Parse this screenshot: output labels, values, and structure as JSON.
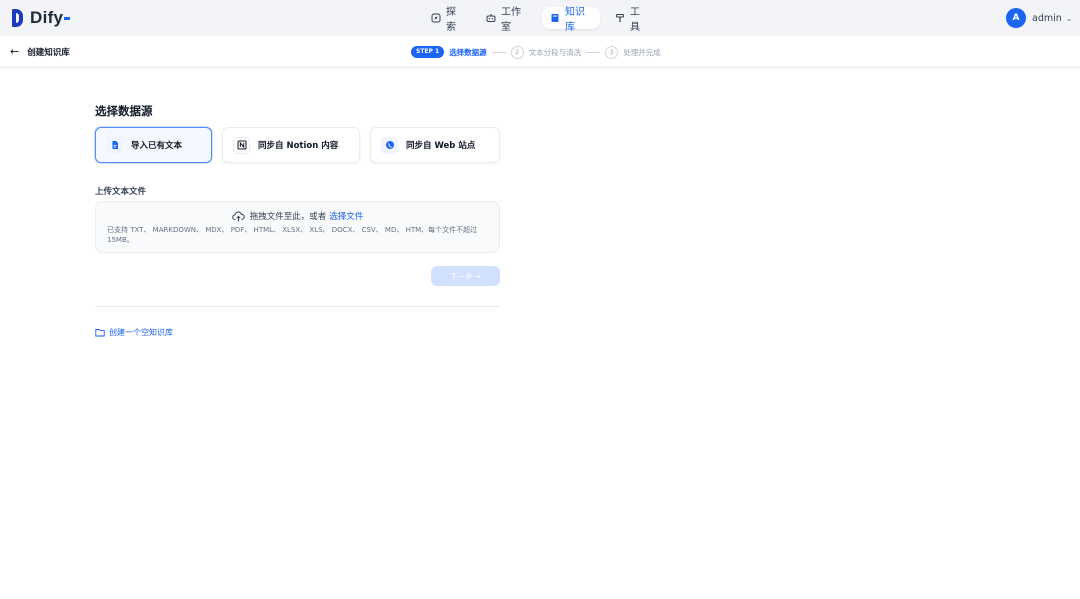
{
  "app": {
    "logo_text": "Dify"
  },
  "nav": {
    "explore": "探索",
    "studio": "工作室",
    "knowledge": "知识库",
    "tools": "工具"
  },
  "user": {
    "avatar_letter": "A",
    "name": "admin"
  },
  "subheader": {
    "back_label": "创建知识库",
    "steps": [
      {
        "badge": "STEP 1",
        "label": "选择数据源",
        "state": "active"
      },
      {
        "number": "2",
        "label": "文本分段与清洗",
        "state": "pending"
      },
      {
        "number": "3",
        "label": "处理并完成",
        "state": "pending"
      }
    ]
  },
  "main": {
    "section_title": "选择数据源",
    "sources": [
      {
        "label": "导入已有文本",
        "icon": "file-icon",
        "selected": true
      },
      {
        "label": "同步自 Notion 内容",
        "icon": "notion-icon",
        "selected": false
      },
      {
        "label": "同步自 Web 站点",
        "icon": "globe-icon",
        "selected": false
      }
    ],
    "upload_title": "上传文本文件",
    "drop_text": "拖拽文件至此，或者",
    "drop_link": "选择文件",
    "supported_text": "已支持 TXT、 MARKDOWN、 MDX、 PDF、 HTML、 XLSX、 XLS、 DOCX、 CSV、 MD、 HTM、每个文件不超过 15MB。",
    "next_button": "下一步 →",
    "create_empty": "创建一个空知识库"
  },
  "colors": {
    "primary": "#1c64f2",
    "topbar_bg": "#f2f4f7",
    "next_disabled": "#d1e0ff"
  }
}
